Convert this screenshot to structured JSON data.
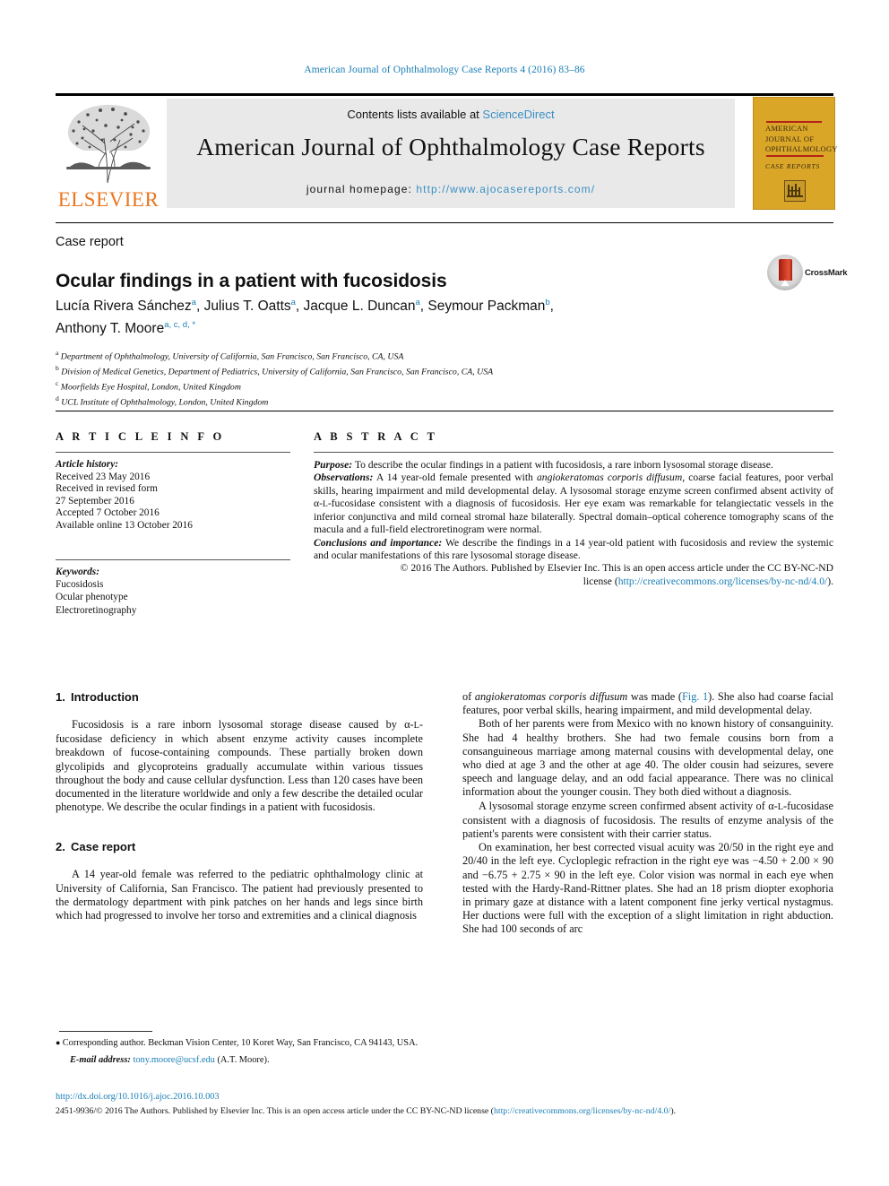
{
  "running_head": "American Journal of Ophthalmology Case Reports 4 (2016) 83–86",
  "masthead": {
    "contents_prefix": "Contents lists available at ",
    "contents_link": "ScienceDirect",
    "journal_title": "American Journal of Ophthalmology Case Reports",
    "homepage_label": "journal homepage:",
    "homepage_url": "http://www.ajocasereports.com/",
    "publisher_logo_text": "ELSEVIER",
    "publisher_logo_icon": "elsevier-tree-icon",
    "cover": {
      "line1": "AMERICAN",
      "line2": "JOURNAL OF",
      "line3": "OPHTHALMOLOGY",
      "line4": "CASE REPORTS",
      "accent_color": "#d9a628",
      "rule_color": "#b32317"
    }
  },
  "article": {
    "type_label": "Case report",
    "title": "Ocular findings in a patient with fucosidosis",
    "crossmark_label": "CrossMark",
    "authors": [
      {
        "name": "Lucía Rivera Sánchez",
        "marks": "a",
        "sep": ", "
      },
      {
        "name": "Julius T. Oatts",
        "marks": "a",
        "sep": ", "
      },
      {
        "name": "Jacque L. Duncan",
        "marks": "a",
        "sep": ", "
      },
      {
        "name": "Seymour Packman",
        "marks": "b",
        "sep": ", "
      },
      {
        "name": "Anthony T. Moore",
        "marks": "a, c, d, *",
        "sep": ""
      }
    ],
    "affiliations": [
      {
        "mark": "a",
        "text": "Department of Ophthalmology, University of California, San Francisco, San Francisco, CA, USA"
      },
      {
        "mark": "b",
        "text": "Division of Medical Genetics, Department of Pediatrics, University of California, San Francisco, San Francisco, CA, USA"
      },
      {
        "mark": "c",
        "text": "Moorfields Eye Hospital, London, United Kingdom"
      },
      {
        "mark": "d",
        "text": "UCL Institute of Ophthalmology, London, United Kingdom"
      }
    ]
  },
  "article_info": {
    "heading": "A R T I C L E  I N F O",
    "history_label": "Article history:",
    "history": [
      "Received 23 May 2016",
      "Received in revised form",
      "27 September 2016",
      "Accepted 7 October 2016",
      "Available online 13 October 2016"
    ],
    "keywords_label": "Keywords:",
    "keywords": [
      "Fucosidosis",
      "Ocular phenotype",
      "Electroretinography"
    ]
  },
  "abstract": {
    "heading": "A B S T R A C T",
    "purpose_label": "Purpose:",
    "purpose_text": " To describe the ocular findings in a patient with fucosidosis, a rare inborn lysosomal storage disease.",
    "observations_label": "Observations:",
    "observations_a": " A 14 year-old female presented with ",
    "observations_italic": "angiokeratomas corporis diffusum",
    "observations_b": ", coarse facial features, poor verbal skills, hearing impairment and mild developmental delay. A lysosomal storage enzyme screen confirmed absent activity of α-",
    "observations_sc": "L",
    "observations_c": "-fucosidase consistent with a diagnosis of fucosidosis. Her eye exam was remarkable for telangiectatic vessels in the inferior conjunctiva and mild corneal stromal haze bilaterally. Spectral domain–optical coherence tomography scans of the macula and a full-field electroretinogram were normal.",
    "conclusions_label": "Conclusions and importance:",
    "conclusions_text": " We describe the findings in a 14 year-old patient with fucosidosis and review the systemic and ocular manifestations of this rare lysosomal storage disease.",
    "copyright_line1": "© 2016 The Authors. Published by Elsevier Inc. This is an open access article under the CC BY-NC-ND",
    "copyright_line2_pre": "license (",
    "copyright_link": "http://creativecommons.org/licenses/by-nc-nd/4.0/",
    "copyright_line2_post": ")."
  },
  "sections": {
    "intro": {
      "number": "1.",
      "title": "Introduction",
      "paragraph": "Fucosidosis is a rare inborn lysosomal storage disease caused by α-|SC|L|/SC|-fucosidase deficiency in which absent enzyme activity causes incomplete breakdown of fucose-containing compounds. These partially broken down glycolipids and glycoproteins gradually accumulate within various tissues throughout the body and cause cellular dysfunction. Less than 120 cases have been documented in the literature worldwide and only a few describe the detailed ocular phenotype. We describe the ocular findings in a patient with fucosidosis."
    },
    "case": {
      "number": "2.",
      "title": "Case report",
      "p1": "A 14 year-old female was referred to the pediatric ophthalmology clinic at University of California, San Francisco. The patient had previously presented to the dermatology department with pink patches on her hands and legs since birth which had progressed to involve her torso and extremities and a clinical diagnosis"
    }
  },
  "right_column": {
    "p1_pre": "of ",
    "p1_italic": "angiokeratomas corporis diffusum",
    "p1_mid": " was made (",
    "p1_link": "Fig. 1",
    "p1_post": "). She also had coarse facial features, poor verbal skills, hearing impairment, and mild developmental delay.",
    "p2": "Both of her parents were from Mexico with no known history of consanguinity. She had 4 healthy brothers. She had two female cousins born from a consanguineous marriage among maternal cousins with developmental delay, one who died at age 3 and the other at age 40. The older cousin had seizures, severe speech and language delay, and an odd facial appearance. There was no clinical information about the younger cousin. They both died without a diagnosis.",
    "p3": "A lysosomal storage enzyme screen confirmed absent activity of α-|SC|L|/SC|-fucosidase consistent with a diagnosis of fucosidosis. The results of enzyme analysis of the patient's parents were consistent with their carrier status.",
    "p4": "On examination, her best corrected visual acuity was 20/50 in the right eye and 20/40 in the left eye. Cycloplegic refraction in the right eye was −4.50 + 2.00 × 90 and −6.75 + 2.75 × 90 in the left eye. Color vision was normal in each eye when tested with the Hardy-Rand-Rittner plates. She had an 18 prism diopter exophoria in primary gaze at distance with a latent component fine jerky vertical nystagmus. Her ductions were full with the exception of a slight limitation in right abduction. She had 100 seconds of arc"
  },
  "footnotes": {
    "corresponding": "Corresponding author. Beckman Vision Center, 10 Koret Way, San Francisco, CA 94143, USA.",
    "email_label": "E-mail address:",
    "email": "tony.moore@ucsf.edu",
    "email_suffix": " (A.T. Moore).",
    "doi": "http://dx.doi.org/10.1016/j.ajoc.2016.10.003",
    "legal_pre": "2451-9936/© 2016 The Authors. Published by Elsevier Inc. This is an open access article under the CC BY-NC-ND license (",
    "legal_link": "http://creativecommons.org/licenses/by-nc-nd/4.0/",
    "legal_post": ")."
  },
  "colors": {
    "link": "#1a7eb5",
    "elsevier_orange": "#e87722",
    "cover_gold": "#d9a628",
    "panel_grey": "#e9e9e9"
  }
}
